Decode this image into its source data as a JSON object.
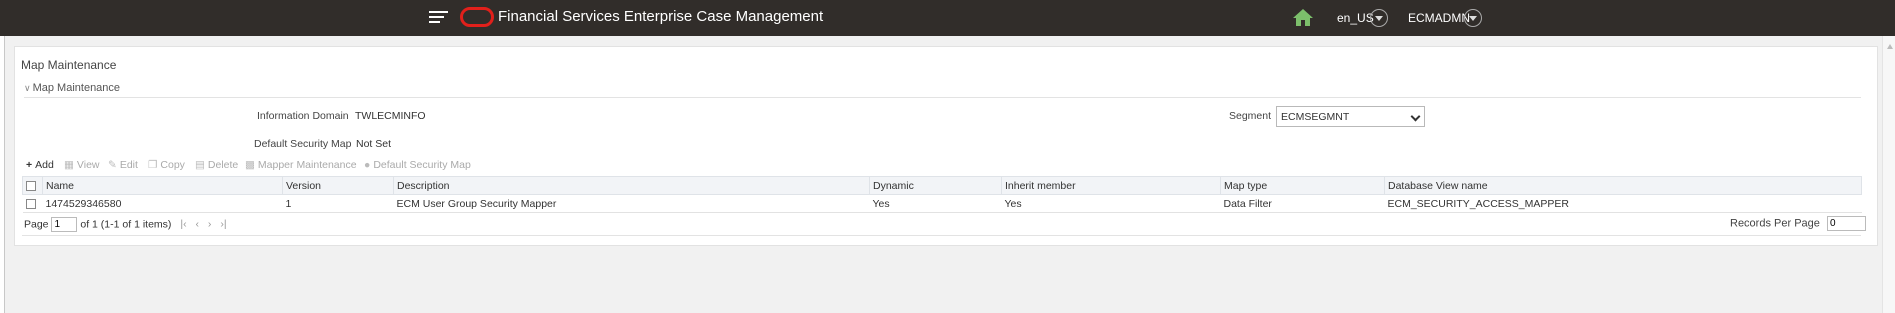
{
  "header": {
    "app_title": "Financial Services Enterprise Case Management",
    "locale": "en_US",
    "user": "ECMADMN",
    "brand_color": "#e1201b",
    "home_icon_color": "#7cbf6b"
  },
  "page": {
    "title": "Map Maintenance",
    "section": "Map Maintenance"
  },
  "form": {
    "info_domain_label": "Information Domain",
    "info_domain_value": "TWLECMINFO",
    "default_map_label": "Default Security Map",
    "default_map_value": "Not Set",
    "segment_label": "Segment",
    "segment_value": "ECMSEGMNT"
  },
  "toolbar": {
    "add": "Add",
    "view": "View",
    "edit": "Edit",
    "copy": "Copy",
    "delete": "Delete",
    "mapper_maintenance": "Mapper Maintenance",
    "default_security_map": "Default Security Map"
  },
  "grid": {
    "columns": [
      "Name",
      "Version",
      "Description",
      "Dynamic",
      "Inherit member",
      "Map type",
      "Database View name"
    ],
    "rows": [
      [
        "1474529346580",
        "1",
        "ECM User Group Security Mapper",
        "Yes",
        "Yes",
        "Data Filter",
        "ECM_SECURITY_ACCESS_MAPPER"
      ]
    ]
  },
  "pager": {
    "page_label": "Page",
    "page_value": "1",
    "of_text": "of 1 (1-1 of 1 items)",
    "rpp_label": "Records Per Page",
    "rpp_value": "0"
  }
}
